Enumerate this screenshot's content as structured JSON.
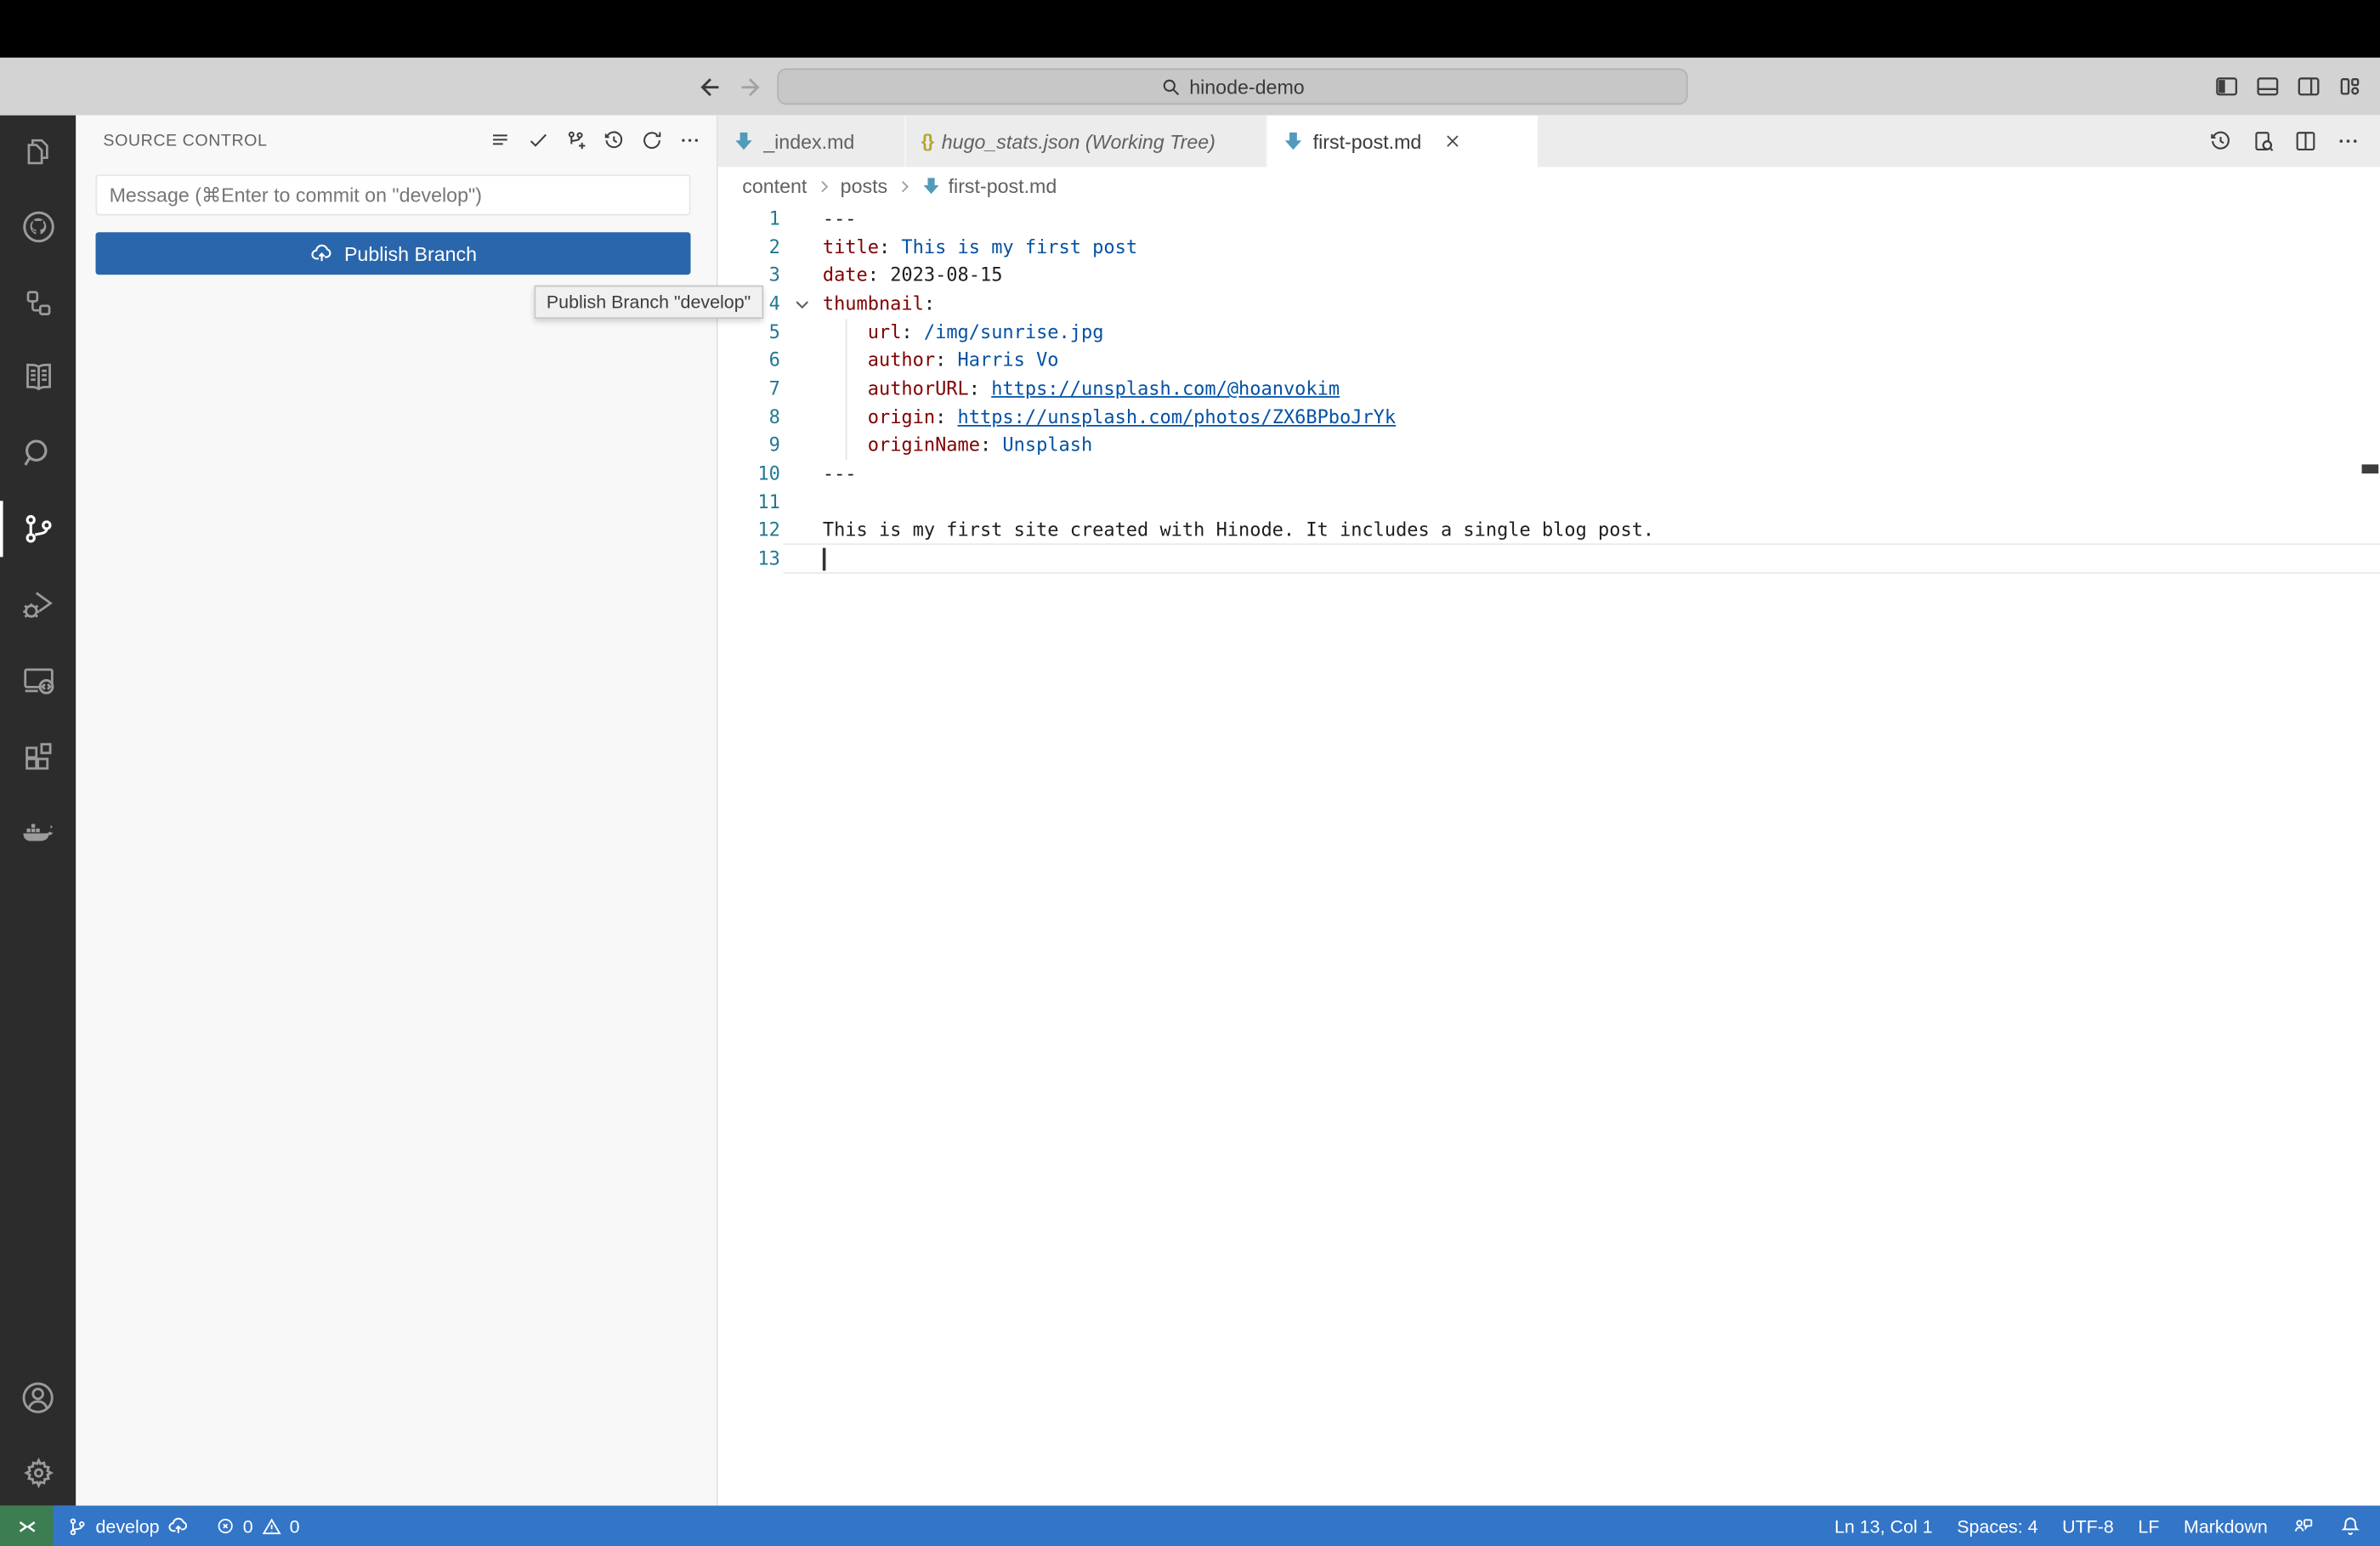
{
  "titlebar": {
    "search_title": "hinode-demo",
    "nav": [
      "back",
      "forward"
    ],
    "layout_icons": [
      "toggle-primary-sidebar",
      "toggle-panel",
      "toggle-secondary-sidebar",
      "customize-layout"
    ]
  },
  "activity_bar": {
    "items": [
      "explorer",
      "github",
      "references",
      "docs-book",
      "search",
      "source-control",
      "run-and-debug",
      "remote-explorer",
      "extensions",
      "docker",
      "accounts",
      "settings"
    ],
    "active": "source-control"
  },
  "sidebar": {
    "title": "SOURCE CONTROL",
    "actions": [
      "view-as-list",
      "commit",
      "create-branch",
      "history",
      "refresh",
      "more-actions"
    ],
    "commit_input_placeholder": "Message (⌘Enter to commit on \"develop\")",
    "publish_button": "Publish Branch",
    "tooltip": "Publish Branch \"develop\""
  },
  "editor": {
    "tabs": [
      {
        "label": "_index.md",
        "icon": "markdown",
        "active": false,
        "italic": false
      },
      {
        "label": "hugo_stats.json (Working Tree)",
        "icon": "json",
        "active": false,
        "italic": true
      },
      {
        "label": "first-post.md",
        "icon": "markdown",
        "active": true,
        "italic": false,
        "closable": true
      }
    ],
    "actions": [
      "timeline",
      "open-changes",
      "split-editor",
      "more-actions"
    ],
    "breadcrumb": {
      "item1": "content",
      "item2": "posts",
      "item3": "first-post.md"
    },
    "json_icon_glyph": "{}",
    "code_lines": [
      {
        "n": "1",
        "tokens": [
          [
            "plain",
            "---"
          ]
        ]
      },
      {
        "n": "2",
        "tokens": [
          [
            "key",
            "title"
          ],
          [
            "plain",
            ": "
          ],
          [
            "str",
            "This is my first post"
          ]
        ]
      },
      {
        "n": "3",
        "tokens": [
          [
            "key",
            "date"
          ],
          [
            "plain",
            ": "
          ],
          [
            "plain",
            "2023-08-15"
          ]
        ]
      },
      {
        "n": "4",
        "fold": true,
        "tokens": [
          [
            "key",
            "thumbnail"
          ],
          [
            "plain",
            ":"
          ]
        ]
      },
      {
        "n": "5",
        "tokens": [
          [
            "plain",
            "    "
          ],
          [
            "key",
            "url"
          ],
          [
            "plain",
            ": "
          ],
          [
            "str",
            "/img/sunrise.jpg"
          ]
        ]
      },
      {
        "n": "6",
        "tokens": [
          [
            "plain",
            "    "
          ],
          [
            "key",
            "author"
          ],
          [
            "plain",
            ": "
          ],
          [
            "str",
            "Harris Vo"
          ]
        ]
      },
      {
        "n": "7",
        "tokens": [
          [
            "plain",
            "    "
          ],
          [
            "key",
            "authorURL"
          ],
          [
            "plain",
            ": "
          ],
          [
            "link",
            "https://unsplash.com/@hoanvokim"
          ]
        ]
      },
      {
        "n": "8",
        "tokens": [
          [
            "plain",
            "    "
          ],
          [
            "key",
            "origin"
          ],
          [
            "plain",
            ": "
          ],
          [
            "link",
            "https://unsplash.com/photos/ZX6BPboJrYk"
          ]
        ]
      },
      {
        "n": "9",
        "tokens": [
          [
            "plain",
            "    "
          ],
          [
            "key",
            "originName"
          ],
          [
            "plain",
            ": "
          ],
          [
            "str",
            "Unsplash"
          ]
        ]
      },
      {
        "n": "10",
        "tokens": [
          [
            "plain",
            "---"
          ]
        ]
      },
      {
        "n": "11",
        "tokens": []
      },
      {
        "n": "12",
        "tokens": [
          [
            "plain",
            "This is my first site created with Hinode. It includes a single blog post."
          ]
        ]
      },
      {
        "n": "13",
        "tokens": [],
        "cursor": true
      }
    ]
  },
  "status_bar": {
    "branch": "develop",
    "errors": "0",
    "warnings": "0",
    "line_col": "Ln 13, Col 1",
    "indentation": "Spaces: 4",
    "encoding": "UTF-8",
    "eol": "LF",
    "language": "Markdown"
  },
  "colors": {
    "statusbar_bg": "#3375c7",
    "remote_bg": "#3c7d52",
    "button_bg": "#2a66ab",
    "markdown_icon": "#519aba",
    "json_icon": "#b4a62b",
    "yaml_key": "#800000",
    "yaml_string": "#0451a5",
    "line_number": "#237893"
  }
}
